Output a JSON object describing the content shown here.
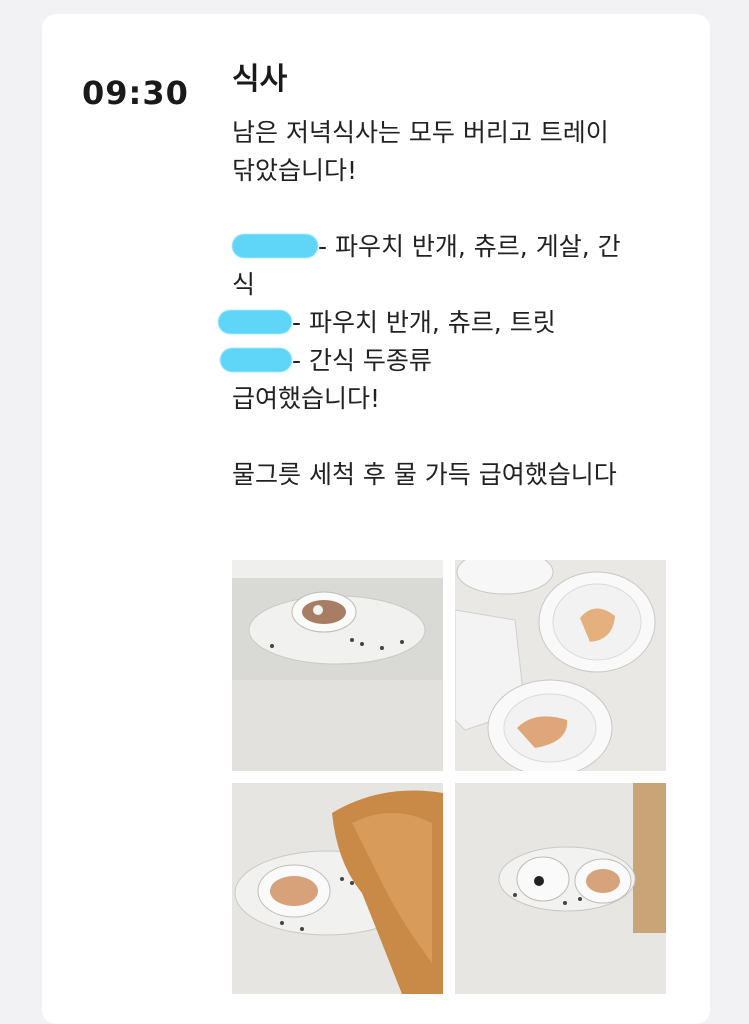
{
  "entry": {
    "time": "09:30",
    "title": "식사",
    "lines": [
      "남은 저녁식사는 모두 버리고 트레이",
      "닦았습니다!",
      "",
      "- 파우치 반개, 츄르, 게살, 간",
      "식",
      "- 파우치 반개, 츄르, 트릿",
      "- 간식 두종류",
      "급여했습니다!",
      "",
      "물그릇 세척 후 물 가득 급여했습니다"
    ]
  },
  "colors": {
    "redaction": "#5fd6f7",
    "card": "#ffffff",
    "background": "#f2f2f4"
  },
  "photos": [
    {
      "name": "photo-tray-with-food-bowl"
    },
    {
      "name": "photo-paper-plates-with-food"
    },
    {
      "name": "photo-cat-eating-from-tray"
    },
    {
      "name": "photo-tray-with-bowl-overhead"
    }
  ]
}
